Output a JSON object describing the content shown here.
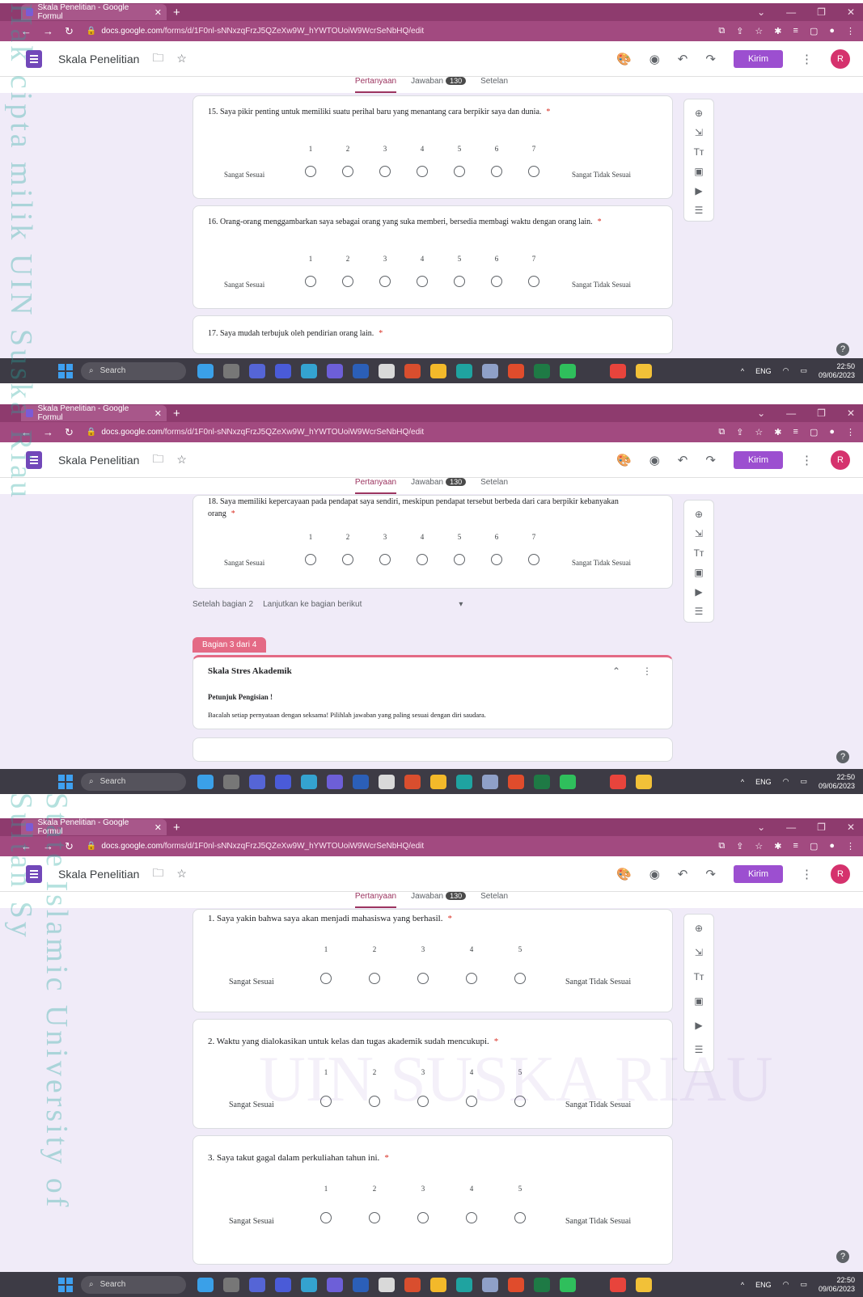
{
  "browser": {
    "tab_title": "Skala Penelitian - Google Formul",
    "url_host": "docs.google.com",
    "url_path": "/forms/d/1F0nl-sNNxzqFrzJ5QZeXw9W_hYWTOUoiW9WcrSeNbHQ/edit"
  },
  "header": {
    "title": "Skala Penelitian",
    "send_label": "Kirim",
    "avatar": "R"
  },
  "tabs": {
    "questions": "Pertanyaan",
    "responses": "Jawaban",
    "responses_count": "130",
    "settings": "Setelan"
  },
  "scale": {
    "left": "Sangat Sesuai",
    "right": "Sangat Tidak Sesuai",
    "seven": [
      "1",
      "2",
      "3",
      "4",
      "5",
      "6",
      "7"
    ],
    "five": [
      "1",
      "2",
      "3",
      "4",
      "5"
    ]
  },
  "shot1": {
    "q15": "15.  Saya pikir penting untuk memiliki suatu perihal baru yang menantang cara berpikir saya dan dunia.",
    "q16": "16.  Orang-orang menggambarkan saya sebagai orang yang suka memberi, bersedia membagi waktu dengan orang lain.",
    "q17": "17. Saya mudah terbujuk oleh pendirian orang lain."
  },
  "shot2": {
    "q18": "18.   Saya memiliki kepercayaan pada  pendapat saya sendiri, meskipun pendapat tersebut berbeda dari cara berpikir kebanyakan orang",
    "after_section": "Setelah bagian 2",
    "after_value": "Lanjutkan ke bagian berikut",
    "section_tag": "Bagian 3 dari 4",
    "section_title": "Skala Stres Akademik",
    "instr_title": "Petunjuk Pengisian !",
    "instr_text": "Bacalah setiap pernyataan dengan seksama! Pilihlah jawaban yang paling sesuai dengan diri saudara."
  },
  "shot3": {
    "q1": "1. Saya yakin bahwa saya akan menjadi mahasiswa yang berhasil.",
    "q2": "2. Waktu yang dialokasikan untuk kelas dan tugas akademik sudah mencukupi.",
    "q3": "3. Saya takut gagal dalam perkuliahan tahun ini."
  },
  "taskbar": {
    "search": "Search",
    "lang": "ENG",
    "time": "22:50",
    "date": "09/06/2023"
  },
  "watermark": {
    "left_top": "Hak cipta milik UIN Suska Riau",
    "left_bottom": "State Islamic University of Sultan Sy",
    "center": "UIN SUSKA RIAU"
  },
  "icons": {
    "forms": "forms-icon",
    "folder": "folder-icon",
    "star": "star-icon",
    "palette": "palette-icon",
    "preview": "eye-icon",
    "undo": "undo-icon",
    "redo": "redo-icon",
    "more": "more-vert-icon"
  }
}
